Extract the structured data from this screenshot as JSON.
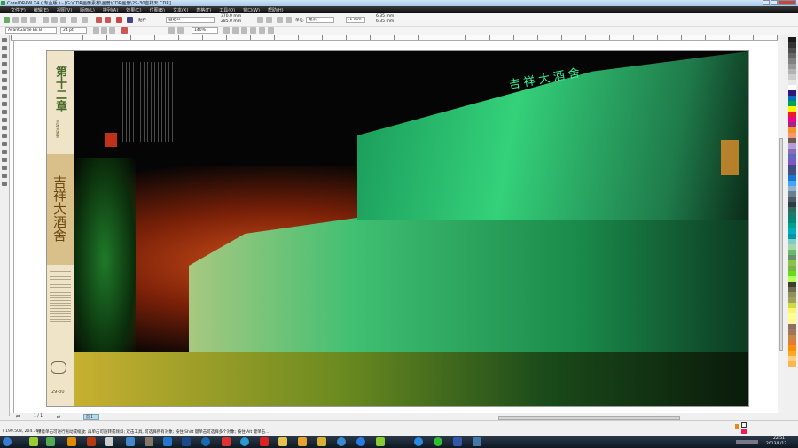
{
  "window": {
    "title": "CorelDRAW X4 ( 专业版 ) - [G:\\CDR画册素材\\画册\\CDR画册\\29-30吉祥天.CDR]"
  },
  "menu": [
    "文件(F)",
    "编辑(E)",
    "视图(V)",
    "版面(L)",
    "排列(A)",
    "效果(C)",
    "位图(B)",
    "文本(X)",
    "表格(T)",
    "工具(O)",
    "窗口(W)",
    "帮助(H)"
  ],
  "toolbar": {
    "snap_label": "贴齐",
    "page_size": "自定义",
    "width": "370.0 mm",
    "height": "285.0 mm",
    "units_label": "单位:",
    "units": "毫米",
    "nudge": ".1 mm",
    "dup_x": "6.35 mm",
    "dup_y": "6.35 mm"
  },
  "text_toolbar": {
    "font": "AvantGarde Bk BT",
    "size": "24 pt",
    "zoom": "140%"
  },
  "document": {
    "chapter": "第十二章",
    "subtitle": "吉祥大酒舍",
    "name": "吉祥大酒舍",
    "page_numbers": "29-30",
    "sign": "吉祥大酒舍"
  },
  "navigator": {
    "page_count": "1 / 1",
    "page_tab": "页 1"
  },
  "status": {
    "coords": "( 199.508, 204.769 )",
    "hint": "接着单击可进行拖动或缩放; 再单击可旋转或倾斜; 双击工具, 可选择所有对象; 按住 Shift 键单击可选择多个对象; 按住 Alt 键单击..."
  },
  "clock": {
    "time": "22:51",
    "date": "2013/1/13"
  },
  "palette": [
    "#1a1a1a",
    "#333",
    "#4d4d4d",
    "#666",
    "#808080",
    "#999",
    "#b3b3b3",
    "#ccc",
    "#e6e6e6",
    "#fff",
    "#2b1a7a",
    "#0072bc",
    "#00a651",
    "#fff200",
    "#ed1c24",
    "#ec008c",
    "#a3238e",
    "#f7941d",
    "#f69679",
    "#6d5a4a",
    "#b39ddb",
    "#8c6bb1",
    "#5c6bc0",
    "#7e57c2",
    "#3f4a8a",
    "#45507a",
    "#1976d2",
    "#42a5f5",
    "#90b4d0",
    "#6b7f8f",
    "#4a5a66",
    "#2e3b40",
    "#2e6b5e",
    "#1b7a6a",
    "#00897b",
    "#00a08a",
    "#00acc1",
    "#0097a7",
    "#80cbc4",
    "#a5d6a7",
    "#66bb6a",
    "#6b8f6b",
    "#8bc34a",
    "#7cb342",
    "#64dd17",
    "#b2ff59",
    "#3e3e2e",
    "#6b6b4e",
    "#8f8f5e",
    "#a0a060",
    "#cddc39",
    "#fff176",
    "#ffff8d",
    "#fff59d",
    "#8d6e63",
    "#a1775b",
    "#c68642",
    "#e07b39",
    "#ff8f00",
    "#ffa726",
    "#ffcc80",
    "#ffb74d"
  ],
  "colors": {
    "accent_green": "#2fe08a",
    "menu_bg": "#111111",
    "strip": "#efe4c8"
  }
}
